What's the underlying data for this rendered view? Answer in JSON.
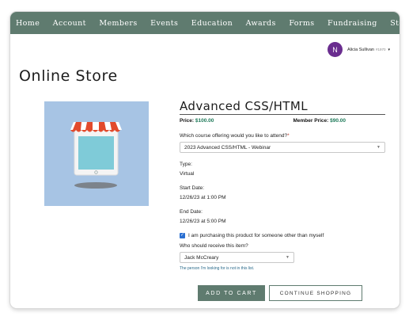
{
  "nav": {
    "items": [
      "Home",
      "Account",
      "Members",
      "Events",
      "Education",
      "Awards",
      "Forms",
      "Fundraising",
      "Store"
    ]
  },
  "user": {
    "initial": "N",
    "name": "Alicia Sullivan",
    "id": "#1970",
    "caret": "▾"
  },
  "page": {
    "title": "Online Store"
  },
  "product": {
    "name": "Advanced CSS/HTML",
    "price_label": "Price:",
    "price": "$100.00",
    "member_price_label": "Member Price:",
    "member_price": "$90.00",
    "offering_question": "Which course offering would you like to attend?",
    "offering_required_mark": "*",
    "offering_selected": "2023 Advanced CSS/HTML - Webinar",
    "type_label": "Type:",
    "type_value": "Virtual",
    "start_label": "Start Date:",
    "start_value": "12/26/23 at 1:00 PM",
    "end_label": "End Date:",
    "end_value": "12/26/23 at 5:00 PM",
    "purchase_for_other_label": "I am purchasing this product for someone other than myself",
    "purchase_for_other_checked": true,
    "recipient_question": "Who should receive this item?",
    "recipient_selected": "Jack McCreary",
    "not_in_list_link": "The person I'm looking for is not in this list."
  },
  "actions": {
    "add_to_cart": "ADD TO CART",
    "continue_shopping": "CONTINUE SHOPPING"
  },
  "colors": {
    "nav_bg": "#5f7b6f",
    "avatar": "#6a2d8f",
    "price": "#1f7a5a",
    "checkbox": "#2a6fd1",
    "image_bg": "#a7c4e4"
  },
  "icons": {
    "store_image": "storefront-tablet-icon",
    "select_arrow": "chevron-down-icon",
    "check": "checkmark-icon"
  }
}
